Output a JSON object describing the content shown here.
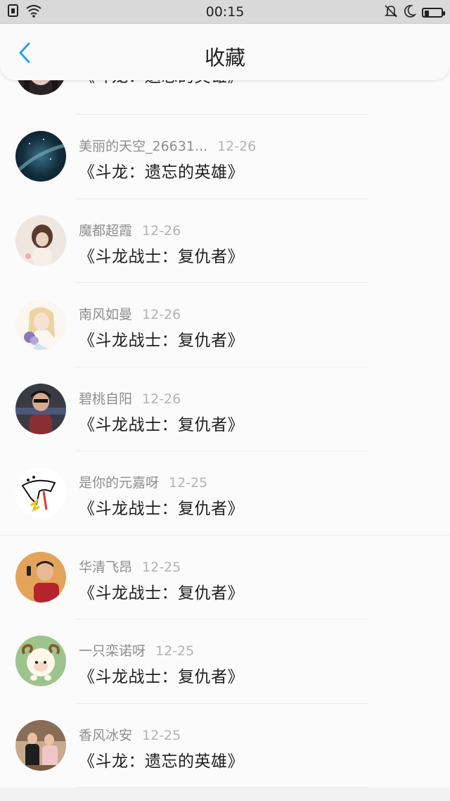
{
  "status_bar": {
    "time": "00:15",
    "icons": [
      "sim-icon",
      "wifi-icon",
      "bell-muted-icon",
      "moon-icon",
      "battery-icon"
    ],
    "battery_level": 0.28
  },
  "header": {
    "title": "收藏",
    "back_icon": "chevron-left-icon",
    "accent": "#2b9ef5"
  },
  "items": [
    {
      "user": "",
      "date": "",
      "title": "《斗龙：遗忘的英雄》"
    },
    {
      "user": "美丽的天空_26631...",
      "date": "12-26",
      "title": "《斗龙：遗忘的英雄》"
    },
    {
      "user": "魔都超霞",
      "date": "12-26",
      "title": "《斗龙战士：复仇者》"
    },
    {
      "user": "南风如曼",
      "date": "12-26",
      "title": "《斗龙战士：复仇者》"
    },
    {
      "user": "碧桃自阳",
      "date": "12-26",
      "title": "《斗龙战士：复仇者》"
    },
    {
      "user": "是你的元嘉呀",
      "date": "12-25",
      "title": "《斗龙战士：复仇者》"
    },
    {
      "user": "华清飞昂",
      "date": "12-25",
      "title": "《斗龙战士：复仇者》"
    },
    {
      "user": "一只栾诺呀",
      "date": "12-25",
      "title": "《斗龙战士：复仇者》"
    },
    {
      "user": "香风冰安",
      "date": "12-25",
      "title": "《斗龙：遗忘的英雄》"
    }
  ]
}
